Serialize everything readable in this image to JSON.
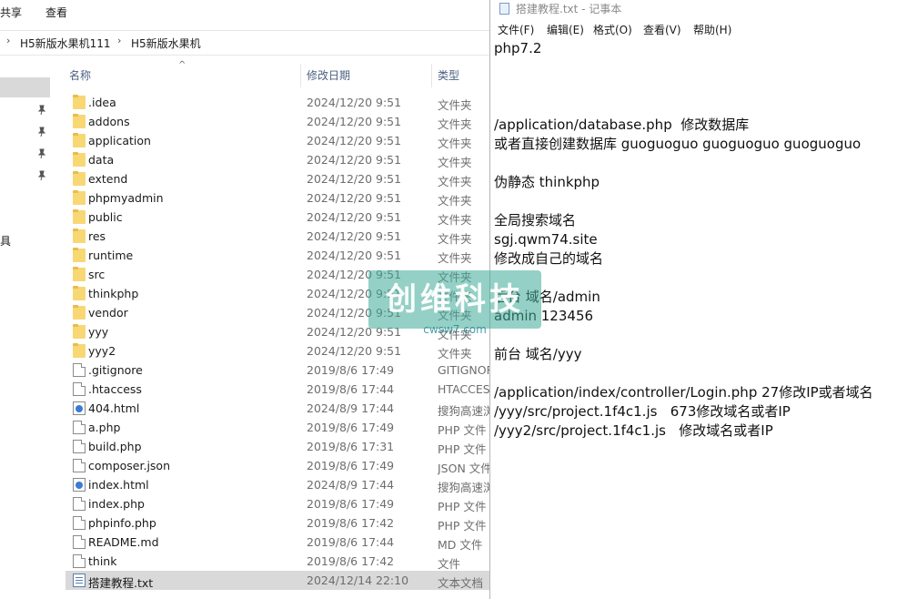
{
  "explorer": {
    "ribbon_tabs": [
      "共享",
      "查看"
    ],
    "breadcrumb": [
      "H5新版水果机111",
      "H5新版水果机"
    ],
    "breadcrumb_separators": [
      "›",
      "›"
    ],
    "nav_label": "具",
    "columns": {
      "name": "名称",
      "date": "修改日期",
      "type": "类型"
    },
    "files": [
      {
        "name": ".idea",
        "date": "2024/12/20 9:51",
        "type": "文件夹",
        "icon": "folder"
      },
      {
        "name": "addons",
        "date": "2024/12/20 9:51",
        "type": "文件夹",
        "icon": "folder"
      },
      {
        "name": "application",
        "date": "2024/12/20 9:51",
        "type": "文件夹",
        "icon": "folder"
      },
      {
        "name": "data",
        "date": "2024/12/20 9:51",
        "type": "文件夹",
        "icon": "folder"
      },
      {
        "name": "extend",
        "date": "2024/12/20 9:51",
        "type": "文件夹",
        "icon": "folder"
      },
      {
        "name": "phpmyadmin",
        "date": "2024/12/20 9:51",
        "type": "文件夹",
        "icon": "folder"
      },
      {
        "name": "public",
        "date": "2024/12/20 9:51",
        "type": "文件夹",
        "icon": "folder"
      },
      {
        "name": "res",
        "date": "2024/12/20 9:51",
        "type": "文件夹",
        "icon": "folder"
      },
      {
        "name": "runtime",
        "date": "2024/12/20 9:51",
        "type": "文件夹",
        "icon": "folder"
      },
      {
        "name": "src",
        "date": "2024/12/20 9:51",
        "type": "文件夹",
        "icon": "folder"
      },
      {
        "name": "thinkphp",
        "date": "2024/12/20 9:51",
        "type": "文件夹",
        "icon": "folder"
      },
      {
        "name": "vendor",
        "date": "2024/12/20 9:51",
        "type": "文件夹",
        "icon": "folder"
      },
      {
        "name": "yyy",
        "date": "2024/12/20 9:51",
        "type": "文件夹",
        "icon": "folder"
      },
      {
        "name": "yyy2",
        "date": "2024/12/20 9:51",
        "type": "文件夹",
        "icon": "folder"
      },
      {
        "name": ".gitignore",
        "date": "2019/8/6 17:49",
        "type": "GITIGNOR",
        "icon": "doc"
      },
      {
        "name": ".htaccess",
        "date": "2019/8/6 17:44",
        "type": "HTACCESS",
        "icon": "doc"
      },
      {
        "name": "404.html",
        "date": "2024/8/9 17:44",
        "type": "搜狗高速浏",
        "icon": "htm"
      },
      {
        "name": "a.php",
        "date": "2019/8/6 17:49",
        "type": "PHP 文件",
        "icon": "doc"
      },
      {
        "name": "build.php",
        "date": "2019/8/6 17:31",
        "type": "PHP 文件",
        "icon": "doc"
      },
      {
        "name": "composer.json",
        "date": "2019/8/6 17:49",
        "type": "JSON 文件",
        "icon": "doc"
      },
      {
        "name": "index.html",
        "date": "2024/8/9 17:44",
        "type": "搜狗高速浏",
        "icon": "htm"
      },
      {
        "name": "index.php",
        "date": "2019/8/6 17:49",
        "type": "PHP 文件",
        "icon": "doc"
      },
      {
        "name": "phpinfo.php",
        "date": "2019/8/6 17:42",
        "type": "PHP 文件",
        "icon": "doc"
      },
      {
        "name": "README.md",
        "date": "2019/8/6 17:44",
        "type": "MD 文件",
        "icon": "doc"
      },
      {
        "name": "think",
        "date": "2019/8/6 17:42",
        "type": "文件",
        "icon": "doc"
      },
      {
        "name": "搭建教程.txt",
        "date": "2024/12/14 22:10",
        "type": "文本文档",
        "icon": "txt",
        "selected": true
      }
    ]
  },
  "notepad": {
    "title": "搭建教程.txt - 记事本",
    "menu": [
      "文件(F)",
      "编辑(E)",
      "格式(O)",
      "查看(V)",
      "帮助(H)"
    ],
    "lines": [
      "php7.2",
      "",
      "",
      "",
      "/application/database.php  修改数据库",
      "或者直接创建数据库 guoguoguo guoguoguo guoguoguo",
      "",
      "伪静态 thinkphp",
      "",
      "全局搜索域名",
      "sgj.qwm74.site",
      "修改成自己的域名",
      "",
      "后台 域名/admin",
      "admin 123456",
      "",
      "前台 域名/yyy",
      "",
      "/application/index/controller/Login.php 27修改IP或者域名",
      "/yyy/src/project.1f4c1.js   673修改域名或者IP",
      "/yyy2/src/project.1f4c1.js   修改域名或者IP"
    ]
  },
  "watermark": {
    "text": "创维科技",
    "url": "cwsw7.com",
    "color": "#3caa96"
  }
}
